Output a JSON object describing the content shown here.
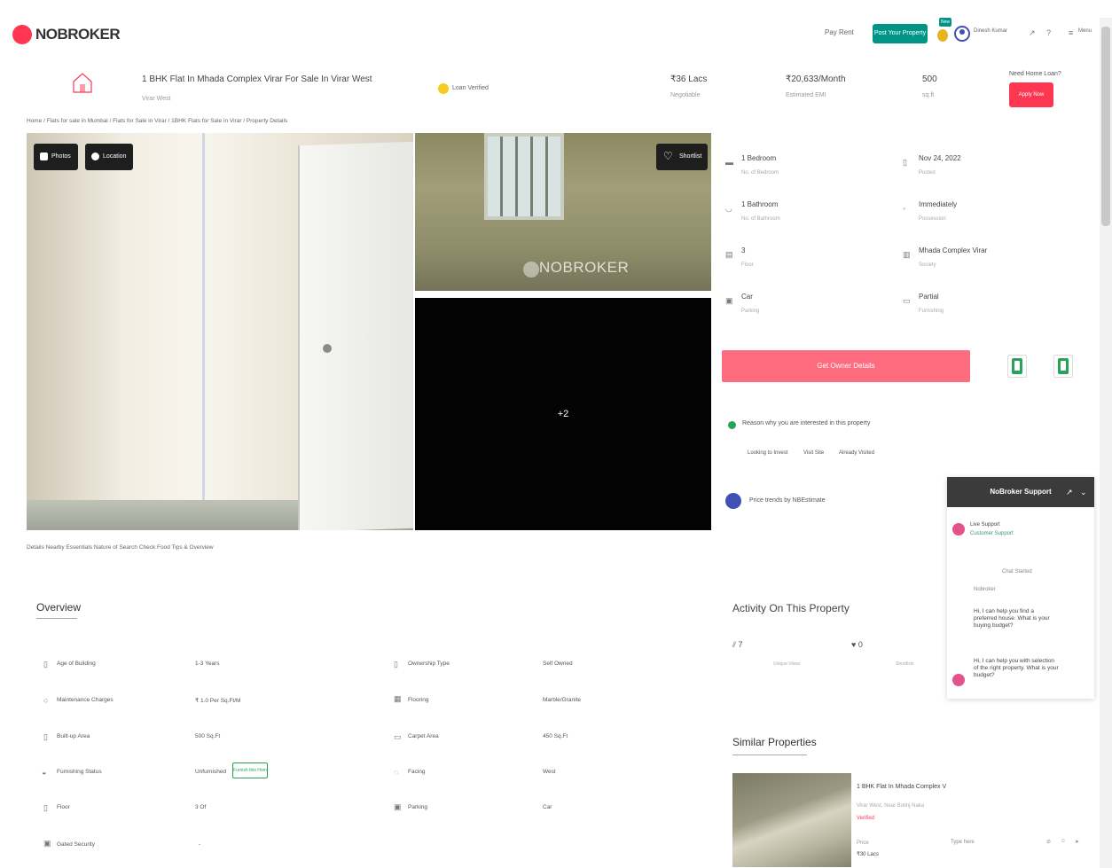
{
  "header": {
    "logo_text": "NOBROKER",
    "nav_link": "Pay Rent",
    "post_button": "Post Your Property",
    "new_badge": "New",
    "user_name": "Dinesh Kumar",
    "menu_label": "Menu"
  },
  "listing": {
    "title": "1 BHK Flat In Mhada Complex Virar For Sale In Virar West",
    "subtitle": "Virar West",
    "verified": "Loan Verified",
    "price": "₹36 Lacs",
    "price_label": "Negotiable",
    "emi": "₹20,633/Month",
    "emi_label": "Estimated EMI",
    "area": "500",
    "area_label": "sq.ft",
    "contact_question": "Need Home Loan?",
    "contact_button": "Apply Now"
  },
  "breadcrumb": "Home  /  Flats for sale in Mumbai  /  Flats for Sale in Virar  /  1BHK Flats for Sale in Virar  /  Property Details",
  "gallery": {
    "photos_btn": "Photos",
    "location_btn": "Location",
    "shortlist_btn": "Shortlist",
    "watermark": "NOBROKER",
    "more_count": "+2"
  },
  "photo_tabs": "Details     Nearby Essentials     Nature of Search     Check     Food     Tips & Overview",
  "details": [
    {
      "value": "1 Bedroom",
      "label": "No. of Bedroom"
    },
    {
      "value": "Nov 24, 2022",
      "label": "Posted"
    },
    {
      "value": "1 Bathroom",
      "label": "No. of Bathroom"
    },
    {
      "value": "Immediately",
      "label": "Possession"
    },
    {
      "value": "3",
      "label": "Floor"
    },
    {
      "value": "Mhada Complex Virar",
      "label": "Society"
    },
    {
      "value": "Car",
      "label": "Parking"
    },
    {
      "value": "Partial",
      "label": "Furnishing"
    }
  ],
  "owner_button": "Get Owner Details",
  "reason": "Reason why you are interested in this property",
  "reason_chips": [
    "Looking to Invest",
    "Visit Site",
    "Already Visited"
  ],
  "nbestimate": "Price trends by NBEstimate",
  "overview": {
    "title": "Overview",
    "rows": [
      {
        "l1": "Age of Building",
        "v1": "1-3 Years",
        "l2": "Ownership Type",
        "v2": "Self Owned"
      },
      {
        "l1": "Maintenance Charges",
        "v1": "₹ 1.0 Per Sq.Ft/M",
        "l2": "Flooring",
        "v2": "Marble/Granite"
      },
      {
        "l1": "Built-up Area",
        "v1": "500 Sq.Ft",
        "l2": "Carpet Area",
        "v2": "450 Sq.Ft"
      },
      {
        "l1": "Furnishing Status",
        "v1": "Unfurnished",
        "l2": "Facing",
        "v2": "West"
      },
      {
        "l1": "Floor",
        "v1": "3 Of",
        "l2": "Parking",
        "v2": "Car"
      },
      {
        "l1": "Gated Security",
        "v1": "-",
        "l2": "",
        "v2": ""
      }
    ],
    "furnish_badge": "Furnish this Home"
  },
  "activity": {
    "title": "Activity On This Property",
    "views": "7",
    "shortlists": "0",
    "views_label": "Unique Views",
    "shortlists_label": "Shortlists"
  },
  "similar": {
    "title": "Similar Properties",
    "item_title": "1 BHK Flat In Mhada Complex V",
    "item_sub": "Virar West, Near Bolinj Naka",
    "item_tag": "Verified",
    "item_price_label": "Price",
    "item_price": "₹30 Lacs"
  },
  "chat": {
    "title": "NoBroker Support",
    "agent_name": "Live Support",
    "agent_role": "Customer Support",
    "chat_started": "Chat Started",
    "help_text": "Hi, I can help you find a preferred house. What is your buying budget?",
    "help_text2": "Hi, I can help you with selection of the right property. What is your budget?",
    "agent_label": "Nobroker",
    "footer_label": "Type here"
  }
}
